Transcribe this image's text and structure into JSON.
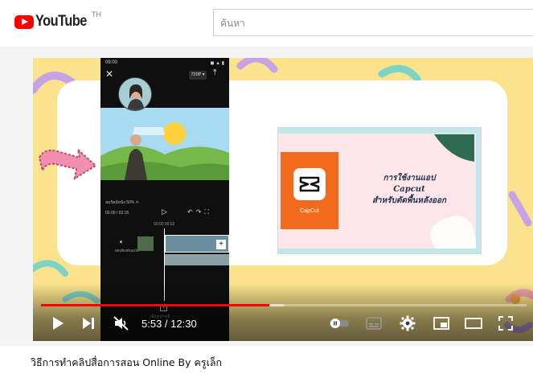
{
  "masthead": {
    "logo_text": "YouTube",
    "country_code": "TH",
    "search_placeholder": "ค้นหา"
  },
  "video_frame": {
    "phone": {
      "status_left": "09:00",
      "status_right": "◼ ▲ ▮",
      "resolution": "720P ▾",
      "caption_label": "สมรัตน์หนัง 50% ✕",
      "timecode": "00:00 / 02:15",
      "ruler": "00:00      00:02",
      "audio_label": "ลดเสียงต้นฉบับ",
      "bottom_label": "เพิ่มรูปภาพนี้"
    },
    "slide": {
      "app_name": "CapCut",
      "title_lines": [
        "การใช้งานแอป",
        "Capcut",
        "สำหรับตัดพื้นหลังออก"
      ]
    }
  },
  "player": {
    "progress_played": 0.47,
    "progress_loaded": 0.5,
    "current_time": "5:53",
    "duration": "12:30",
    "time_separator": " / ",
    "colors": {
      "progress": "#ff0000",
      "accent_bg": "#fae38c"
    },
    "icons": [
      "play-icon",
      "next-icon",
      "mute-icon",
      "autoplay-toggle-icon",
      "subtitles-icon",
      "settings-icon",
      "miniplayer-icon",
      "theater-icon",
      "fullscreen-icon"
    ]
  },
  "video": {
    "title": "วิธีการทำคลิปสื่อการสอน Online By ครูเล็ก"
  }
}
